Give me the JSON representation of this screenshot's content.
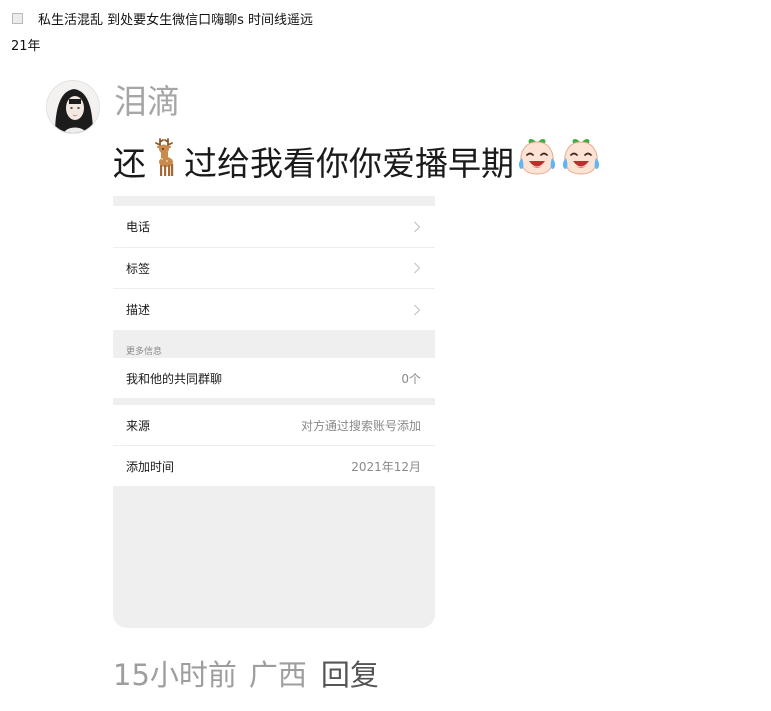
{
  "header": {
    "title": "私生活混乱 到处要女生微信口嗨聊s 时间线遥远",
    "year": "21年"
  },
  "comment": {
    "username": "泪滴",
    "text_before": "还",
    "text_after": "过给我看你你爱播早期",
    "emoji_deer": "deer",
    "emoji_face": "crying-laughing-peach-face",
    "time": "15小时前",
    "location": "广西",
    "reply_label": "回复"
  },
  "screenshot_card": {
    "rows": [
      {
        "label": "电话",
        "value": "",
        "chevron": true
      },
      {
        "label": "标签",
        "value": "",
        "chevron": true
      },
      {
        "label": "描述",
        "value": "",
        "chevron": true
      }
    ],
    "section_label": "更多信息",
    "groups_row": {
      "label": "我和他的共同群聊",
      "value": "0个"
    },
    "source_row": {
      "label": "来源",
      "value": "对方通过搜索账号添加"
    },
    "added_row": {
      "label": "添加时间",
      "value": "2021年12月"
    }
  },
  "colors": {
    "username": "#a6a6a6",
    "meta": "#9e9e9e",
    "card_background": "#efefef"
  }
}
